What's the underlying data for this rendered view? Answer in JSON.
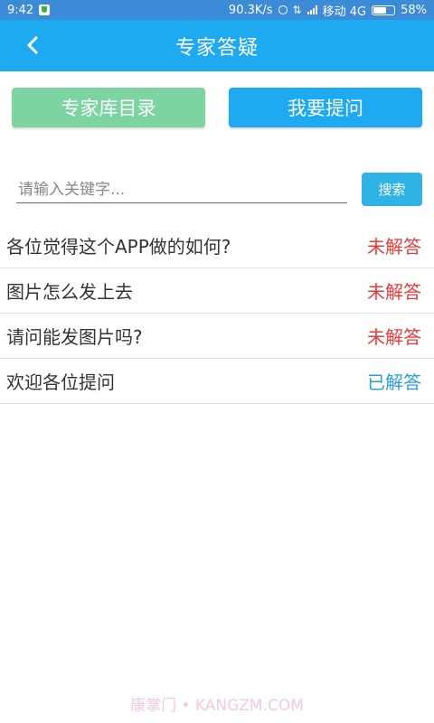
{
  "status_bar": {
    "time": "9:42",
    "speed": "90.3K/s",
    "carrier": "移动 4G",
    "battery": "58%",
    "battery_level": 0.58
  },
  "header": {
    "title": "专家答疑",
    "back_icon": "chevron-left-icon"
  },
  "buttons": {
    "directory": "专家库目录",
    "ask": "我要提问"
  },
  "search": {
    "placeholder": "请输入关键字...",
    "value": "",
    "button": "搜索"
  },
  "questions": [
    {
      "text": "各位觉得这个APP做的如何?",
      "status": "未解答",
      "color": "#e83a3a"
    },
    {
      "text": "图片怎么发上去",
      "status": "未解答",
      "color": "#e83a3a"
    },
    {
      "text": "请问能发图片吗?",
      "status": "未解答",
      "color": "#e83a3a"
    },
    {
      "text": "欢迎各位提问",
      "status": "已解答",
      "color": "#2a9ee0"
    }
  ],
  "watermark": "康掌门 • KANGZM.COM",
  "colors": {
    "header": "#1eaaf1",
    "statusbar": "#3b8bd6",
    "directory_button": "#7cd5a0",
    "ask_button": "#1eaaf1",
    "search_button": "#2fb2e6"
  }
}
